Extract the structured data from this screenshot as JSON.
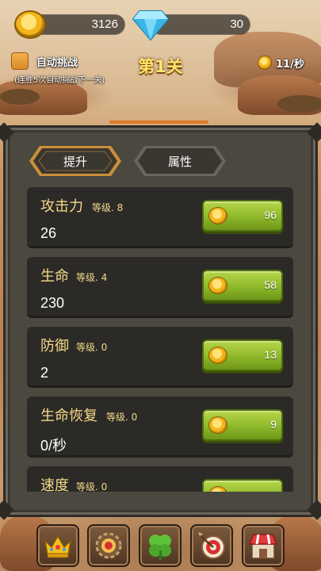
{
  "resources": {
    "gold": "3126",
    "diamond": "30"
  },
  "auto_challenge": {
    "label": "自动挑战",
    "note": "(连胜5次自动挑战下一关)"
  },
  "level_title": "第1关",
  "gold_rate": "11/秒",
  "tabs": [
    {
      "label": "提升",
      "active": true
    },
    {
      "label": "属性",
      "active": false
    }
  ],
  "stats": [
    {
      "name": "攻击力",
      "level": "等级. 8",
      "value": "26",
      "cost": "96"
    },
    {
      "name": "生命",
      "level": "等级. 4",
      "value": "230",
      "cost": "58"
    },
    {
      "name": "防御",
      "level": "等级. 0",
      "value": "2",
      "cost": "13"
    },
    {
      "name": "生命恢复",
      "level": "等级. 0",
      "value": "0/秒",
      "cost": "9"
    },
    {
      "name": "速度",
      "level": "等级. 0",
      "value": "",
      "cost": ""
    }
  ],
  "nav": [
    {
      "icon": "crown-icon"
    },
    {
      "icon": "gear-gem-icon"
    },
    {
      "icon": "clover-icon"
    },
    {
      "icon": "target-icon"
    },
    {
      "icon": "shop-icon"
    }
  ],
  "colors": {
    "accent_gold": "#f5d98a",
    "button_green": "#8db82a",
    "panel": "#4b4840",
    "card": "#2b2a26"
  }
}
